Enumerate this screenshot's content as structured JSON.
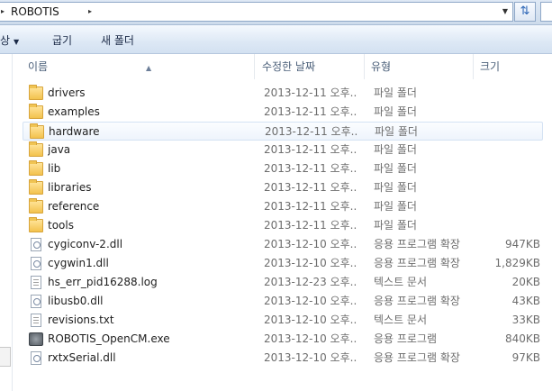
{
  "address_bar": {
    "path_segment": "ROBOTIS",
    "refresh_icon": "refresh-icon"
  },
  "toolbar": {
    "organize_partial": "상",
    "share_label": "굽기",
    "new_folder_label": "새 폴더"
  },
  "columns": {
    "name": "이름",
    "date": "수정한 날짜",
    "type": "유형",
    "size": "크기"
  },
  "files": [
    {
      "name": "drivers",
      "date": "2013-12-11 오후...",
      "type": "파일 폴더",
      "size": "",
      "icon": "folder-icon"
    },
    {
      "name": "examples",
      "date": "2013-12-11 오후...",
      "type": "파일 폴더",
      "size": "",
      "icon": "folder-icon"
    },
    {
      "name": "hardware",
      "date": "2013-12-11 오후...",
      "type": "파일 폴더",
      "size": "",
      "icon": "folder-icon"
    },
    {
      "name": "java",
      "date": "2013-12-11 오후...",
      "type": "파일 폴더",
      "size": "",
      "icon": "folder-icon"
    },
    {
      "name": "lib",
      "date": "2013-12-11 오후...",
      "type": "파일 폴더",
      "size": "",
      "icon": "folder-icon"
    },
    {
      "name": "libraries",
      "date": "2013-12-11 오후...",
      "type": "파일 폴더",
      "size": "",
      "icon": "folder-icon"
    },
    {
      "name": "reference",
      "date": "2013-12-11 오후...",
      "type": "파일 폴더",
      "size": "",
      "icon": "folder-icon"
    },
    {
      "name": "tools",
      "date": "2013-12-11 오후...",
      "type": "파일 폴더",
      "size": "",
      "icon": "folder-icon"
    },
    {
      "name": "cygiconv-2.dll",
      "date": "2013-12-10 오후...",
      "type": "응용 프로그램 확장",
      "size": "947KB",
      "icon": "dll-icon"
    },
    {
      "name": "cygwin1.dll",
      "date": "2013-12-10 오후...",
      "type": "응용 프로그램 확장",
      "size": "1,829KB",
      "icon": "dll-icon"
    },
    {
      "name": "hs_err_pid16288.log",
      "date": "2013-12-23 오후...",
      "type": "텍스트 문서",
      "size": "20KB",
      "icon": "text-file-icon"
    },
    {
      "name": "libusb0.dll",
      "date": "2013-12-10 오후...",
      "type": "응용 프로그램 확장",
      "size": "43KB",
      "icon": "dll-icon"
    },
    {
      "name": "revisions.txt",
      "date": "2013-12-10 오후...",
      "type": "텍스트 문서",
      "size": "33KB",
      "icon": "text-file-icon"
    },
    {
      "name": "ROBOTIS_OpenCM.exe",
      "date": "2013-12-10 오후...",
      "type": "응용 프로그램",
      "size": "840KB",
      "icon": "exe-icon"
    },
    {
      "name": "rxtxSerial.dll",
      "date": "2013-12-10 오후...",
      "type": "응용 프로그램 확장",
      "size": "97KB",
      "icon": "dll-icon"
    }
  ],
  "selected_item": "hardware",
  "colors": {
    "selection_border": "#d4e2f3",
    "toolbar_bg": "#dde8f5",
    "header_text": "#4c607a",
    "secondary_text": "#6d6d6d"
  }
}
